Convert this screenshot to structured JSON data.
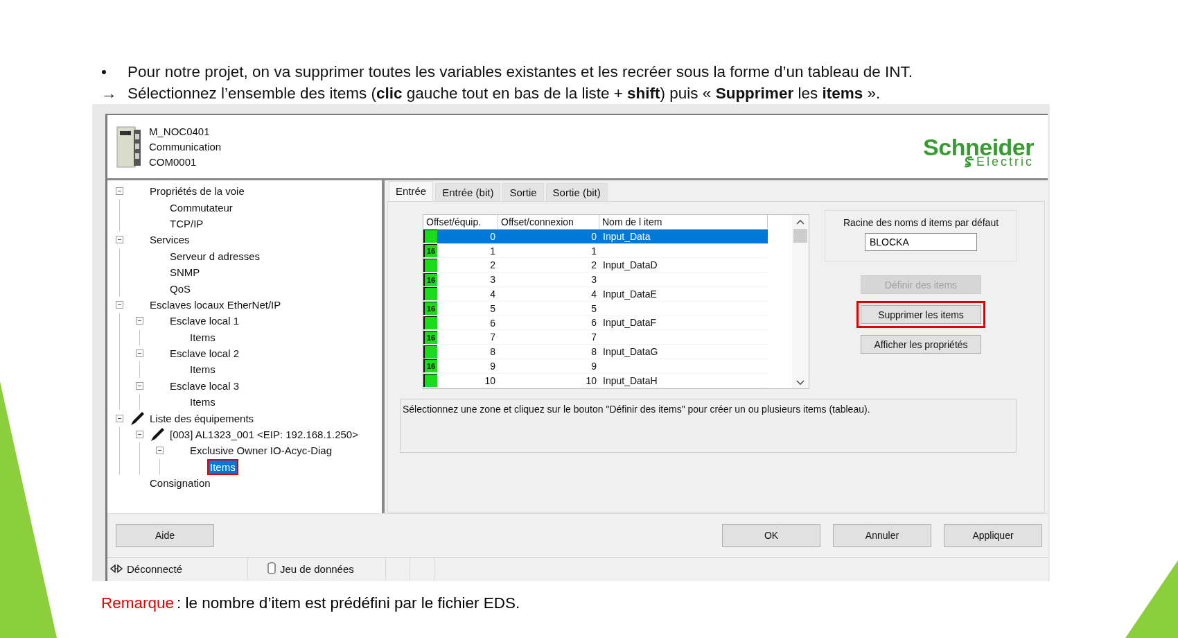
{
  "instructions": [
    {
      "mark": "•",
      "text": "Pour notre projet, on va supprimer toutes les variables existantes et les recréer sous la forme d’un tableau de INT."
    },
    {
      "mark": "→",
      "text": "Sélectionnez l’ensemble des items (**clic** gauche tout en bas de la liste + **shift**) puis « **Supprimer** les **items** »."
    }
  ],
  "module": {
    "lines": [
      "M_NOC0401",
      "Communication",
      "COM0001"
    ]
  },
  "logo": {
    "brand": "Schneider",
    "sub": "Electric"
  },
  "tree": [
    {
      "label": "Propriétés de la voie",
      "expanded": true,
      "selected": false,
      "children": [
        {
          "label": "Commutateur",
          "selected": false
        },
        {
          "label": "TCP/IP",
          "selected": false
        }
      ]
    },
    {
      "label": "Services",
      "expanded": true,
      "selected": false,
      "children": [
        {
          "label": "Serveur d adresses",
          "selected": false
        },
        {
          "label": "SNMP",
          "selected": false
        },
        {
          "label": "QoS",
          "selected": false
        }
      ]
    },
    {
      "label": "Esclaves locaux EtherNet/IP",
      "expanded": true,
      "selected": false,
      "children": [
        {
          "label": "Esclave local 1",
          "expanded": true,
          "selected": false,
          "children": [
            {
              "label": "Items",
              "selected": false
            }
          ]
        },
        {
          "label": "Esclave local 2",
          "expanded": true,
          "selected": false,
          "children": [
            {
              "label": "Items",
              "selected": false
            }
          ]
        },
        {
          "label": "Esclave local 3",
          "expanded": true,
          "selected": false,
          "children": [
            {
              "label": "Items",
              "selected": false
            }
          ]
        }
      ]
    },
    {
      "label": "Liste des équipements",
      "expanded": true,
      "edited": true,
      "selected": false,
      "children": [
        {
          "label": "[003] AL1323_001 <EIP: 192.168.1.250>",
          "expanded": true,
          "edited": true,
          "selected": false,
          "children": [
            {
              "label": "Exclusive Owner IO-Acyc-Diag",
              "expanded": true,
              "selected": false,
              "children": [
                {
                  "label": "Items",
                  "selected": true,
                  "highlighted": true
                }
              ]
            }
          ]
        }
      ]
    },
    {
      "label": "Consignation",
      "selected": false
    }
  ],
  "tabs": [
    {
      "label": "Entrée",
      "selected": true
    },
    {
      "label": "Entrée (bit)",
      "selected": false
    },
    {
      "label": "Sortie",
      "selected": false
    },
    {
      "label": "Sortie (bit)",
      "selected": false
    }
  ],
  "table": {
    "columns": [
      "Offset/équip.",
      "Offset/connexion",
      "Nom de l item"
    ],
    "rows": [
      {
        "offset_device": "0",
        "offset_connection": "0",
        "name": "Input_Data",
        "selected": true
      },
      {
        "tag": "16",
        "offset_device": "1",
        "offset_connection": "1",
        "selected": false
      },
      {
        "offset_device": "2",
        "offset_connection": "2",
        "name": "Input_DataD",
        "selected": false
      },
      {
        "tag": "16",
        "offset_device": "3",
        "offset_connection": "3",
        "selected": false
      },
      {
        "offset_device": "4",
        "offset_connection": "4",
        "name": "Input_DataE",
        "selected": false
      },
      {
        "tag": "16",
        "offset_device": "5",
        "offset_connection": "5",
        "selected": false
      },
      {
        "offset_device": "6",
        "offset_connection": "6",
        "name": "Input_DataF",
        "selected": false
      },
      {
        "tag": "16",
        "offset_device": "7",
        "offset_connection": "7",
        "selected": false
      },
      {
        "offset_device": "8",
        "offset_connection": "8",
        "name": "Input_DataG",
        "selected": false
      },
      {
        "tag": "16",
        "offset_device": "9",
        "offset_connection": "9",
        "selected": false
      },
      {
        "offset_device": "10",
        "offset_connection": "10",
        "name": "Input_DataH",
        "selected": false
      }
    ]
  },
  "name_root": {
    "label": "Racine des noms d items par défaut",
    "value": "BLOCKA"
  },
  "side_buttons": [
    {
      "label": "Définir des items",
      "disabled": true,
      "highlighted": false
    },
    {
      "label": "Supprimer les items",
      "disabled": false,
      "highlighted": true
    },
    {
      "label": "Afficher les propriétés",
      "disabled": false,
      "highlighted": false
    }
  ],
  "description": "Sélectionnez une zone et cliquez sur le bouton \"Définir des items\" pour créer un ou plusieurs items (tableau).",
  "help_button": "Aide",
  "dialog_buttons": [
    "OK",
    "Annuler",
    "Appliquer"
  ],
  "status_bar": [
    {
      "kind": "connection",
      "label": "Déconnecté"
    },
    {
      "kind": "dataset",
      "label": "Jeu de données"
    }
  ],
  "remark": {
    "label": "Remarque",
    "text": ": le nombre d’item est prédéfini par le fichier EDS."
  }
}
